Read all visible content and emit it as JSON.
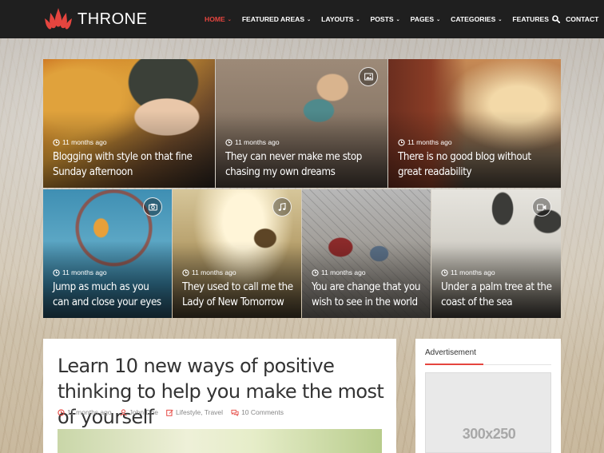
{
  "site": {
    "name": "THRONE"
  },
  "nav": {
    "items": [
      {
        "label": "HOME",
        "caret": "⌄",
        "active": true
      },
      {
        "label": "FEATURED AREAS",
        "caret": "⌄"
      },
      {
        "label": "LAYOUTS",
        "caret": "⌄"
      },
      {
        "label": "POSTS",
        "caret": "⌄"
      },
      {
        "label": "PAGES",
        "caret": "⌄"
      },
      {
        "label": "CATEGORIES",
        "caret": "⌄"
      },
      {
        "label": "FEATURES",
        "caret": "⌄"
      },
      {
        "label": "CONTACT"
      }
    ],
    "search_icon": "search-icon"
  },
  "featured": [
    {
      "time": "11 months ago",
      "title": "Blogging with style on that fine Sunday afternoon",
      "format_icon": null
    },
    {
      "time": "11 months ago",
      "title": "They can never make me stop chasing my own dreams",
      "format_icon": "image-icon"
    },
    {
      "time": "11 months ago",
      "title": "There is no good blog without great readability",
      "format_icon": null
    },
    {
      "time": "11 months ago",
      "title": "Jump as much as you can and close your eyes",
      "format_icon": "camera-icon"
    },
    {
      "time": "11 months ago",
      "title": "They used to call me the Lady of New Tomorrow",
      "format_icon": "music-icon"
    },
    {
      "time": "11 months ago",
      "title": "You are change that you wish to see in the world",
      "format_icon": null
    },
    {
      "time": "11 months ago",
      "title": "Under a palm tree at the coast of the sea",
      "format_icon": "video-icon"
    }
  ],
  "article": {
    "title": "Learn 10 new ways of positive thinking to help you make the most of yourself",
    "time": "11 months ago",
    "author": "John Doe",
    "categories": "Lifestyle, Travel",
    "comments": "10 Comments"
  },
  "sidebar": {
    "widget_title": "Advertisement",
    "ad_label": "300x250"
  },
  "colors": {
    "accent": "#e5453f",
    "header_bg": "#1f1f1f"
  }
}
